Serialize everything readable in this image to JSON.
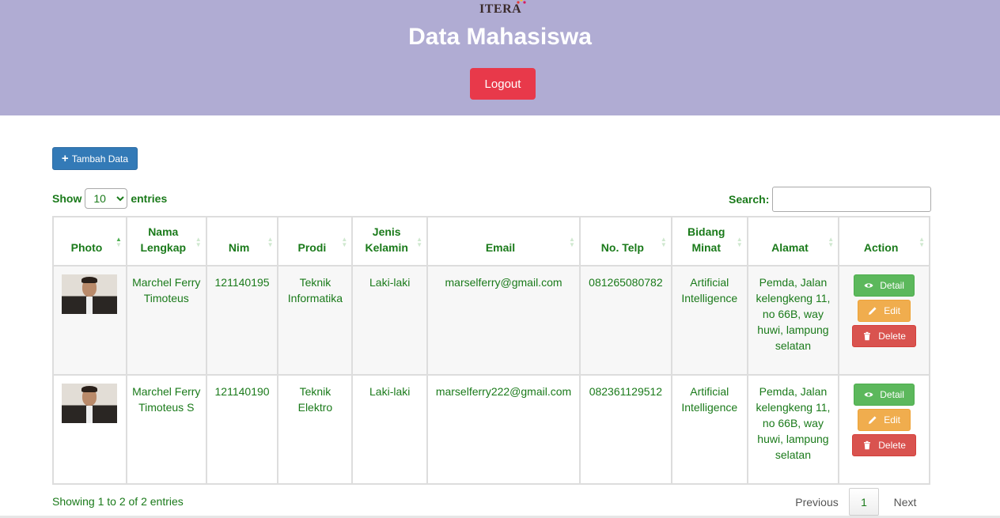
{
  "header": {
    "logo_text": "ITERA",
    "title": "Data Mahasiswa",
    "logout_label": "Logout",
    "bg_color": "#b0acd3"
  },
  "toolbar": {
    "add_label": "Tambah Data",
    "show_label": "Show",
    "entries_value": "10",
    "entries_label": "entries",
    "search_label": "Search:",
    "search_value": ""
  },
  "table": {
    "columns": [
      "Photo",
      "Nama Lengkap",
      "Nim",
      "Prodi",
      "Jenis Kelamin",
      "Email",
      "No. Telp",
      "Bidang Minat",
      "Alamat",
      "Action"
    ],
    "rows": [
      {
        "nama": "Marchel Ferry Timoteus",
        "nim": "121140195",
        "prodi": "Teknik Informatika",
        "jk": "Laki-laki",
        "email": "marselferry@gmail.com",
        "telp": "081265080782",
        "bidang": "Artificial Intelligence",
        "alamat": "Pemda, Jalan kelengkeng 11, no 66B, way huwi, lampung selatan"
      },
      {
        "nama": "Marchel Ferry Timoteus S",
        "nim": "121140190",
        "prodi": "Teknik Elektro",
        "jk": "Laki-laki",
        "email": "marselferry222@gmail.com",
        "telp": "082361129512",
        "bidang": "Artificial Intelligence",
        "alamat": "Pemda, Jalan kelengkeng 11, no 66B, way huwi, lampung selatan"
      }
    ],
    "actions": {
      "detail": "Detail",
      "edit": "Edit",
      "delete": "Delete"
    }
  },
  "footer": {
    "info": "Showing 1 to 2 of 2 entries",
    "previous": "Previous",
    "page": "1",
    "next": "Next"
  }
}
